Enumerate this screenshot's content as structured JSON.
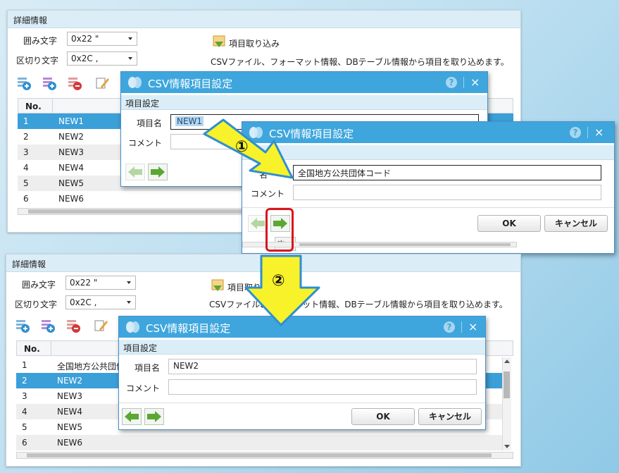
{
  "detail_label": "詳細情報",
  "enclosure_label": "囲み文字",
  "enclosure_value": "0x22 \"",
  "delimiter_label": "区切り文字",
  "delimiter_value": "0x2C ,",
  "import_label": "項目取り込み",
  "import_desc": "CSVファイル、フォーマット情報、DBテーブル情報から項目を取り込めます。",
  "grid_no_header": "No.",
  "top_rows": [
    {
      "no": "1",
      "name": "NEW1"
    },
    {
      "no": "2",
      "name": "NEW2"
    },
    {
      "no": "3",
      "name": "NEW3"
    },
    {
      "no": "4",
      "name": "NEW4"
    },
    {
      "no": "5",
      "name": "NEW5"
    },
    {
      "no": "6",
      "name": "NEW6"
    }
  ],
  "bottom_rows": [
    {
      "no": "1",
      "name": "全国地方公共団体"
    },
    {
      "no": "2",
      "name": "NEW2"
    },
    {
      "no": "3",
      "name": "NEW3"
    },
    {
      "no": "4",
      "name": "NEW4"
    },
    {
      "no": "5",
      "name": "NEW5"
    },
    {
      "no": "6",
      "name": "NEW6"
    }
  ],
  "dialog_title": "CSV情報項目設定",
  "section_label": "項目設定",
  "item_name_label": "項目名",
  "item_name_label_partial": "名",
  "comment_label": "コメント",
  "dialog1_item_value": "NEW1",
  "dialog2_item_value": "全国地方公共団体コード",
  "dialog3_item_value": "NEW2",
  "ok_label": "OK",
  "cancel_label": "キャンセル",
  "next_label": "次へ",
  "help_glyph": "?",
  "close_glyph": "×",
  "step1_label": "①",
  "step2_label": "②",
  "colors": {
    "title_bar": "#3ea6dd",
    "selected_row": "#3b9fd8",
    "arrow_fill": "#f7f22a",
    "arrow_stroke": "#2f8fd0",
    "highlight_box": "#d9161c",
    "nav_arrow": "#5aa832"
  },
  "icons": [
    "add-row-icon",
    "insert-row-icon",
    "delete-row-icon",
    "edit-icon",
    "import-icon",
    "logo-icon",
    "help-icon",
    "close-icon",
    "arrow-left-icon",
    "arrow-right-icon"
  ]
}
